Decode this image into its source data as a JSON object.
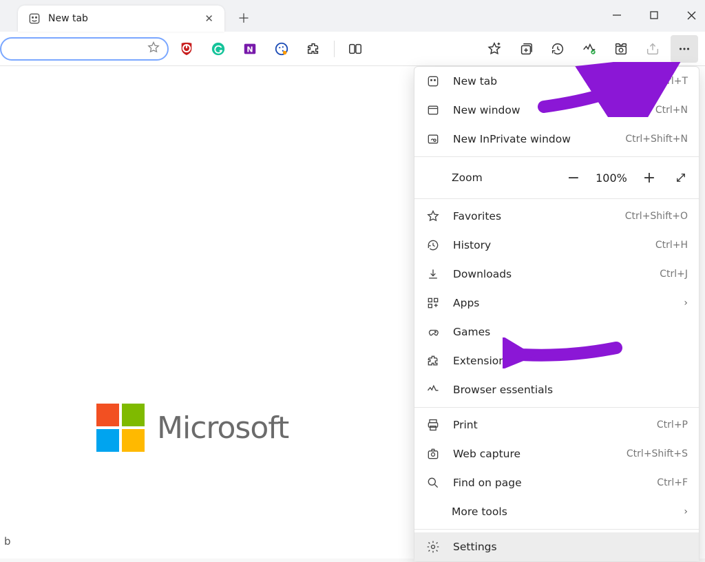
{
  "tab": {
    "title": "New tab"
  },
  "window": {
    "caption_buttons": [
      "min",
      "max",
      "close"
    ]
  },
  "page": {
    "brand": "Microsoft",
    "corner_text": "b"
  },
  "zoom": {
    "label": "Zoom",
    "value": "100%"
  },
  "menu": {
    "items": [
      {
        "icon": "new-tab",
        "label": "New tab",
        "accel": "Ctrl+T"
      },
      {
        "icon": "window",
        "label": "New window",
        "accel": "Ctrl+N"
      },
      {
        "icon": "inprivate",
        "label": "New InPrivate window",
        "accel": "Ctrl+Shift+N"
      }
    ],
    "items2": [
      {
        "icon": "star",
        "label": "Favorites",
        "accel": "Ctrl+Shift+O"
      },
      {
        "icon": "history",
        "label": "History",
        "accel": "Ctrl+H"
      },
      {
        "icon": "download",
        "label": "Downloads",
        "accel": "Ctrl+J"
      },
      {
        "icon": "apps",
        "label": "Apps",
        "chev": true
      },
      {
        "icon": "games",
        "label": "Games"
      },
      {
        "icon": "puzzle",
        "label": "Extensions"
      },
      {
        "icon": "heart",
        "label": "Browser essentials"
      }
    ],
    "items3": [
      {
        "icon": "print",
        "label": "Print",
        "accel": "Ctrl+P"
      },
      {
        "icon": "capture",
        "label": "Web capture",
        "accel": "Ctrl+Shift+S"
      },
      {
        "icon": "find",
        "label": "Find on page",
        "accel": "Ctrl+F"
      },
      {
        "icon": "",
        "label": "More tools",
        "chev": true
      }
    ],
    "items4": [
      {
        "icon": "gear",
        "label": "Settings",
        "hl": true
      }
    ]
  },
  "annotations": {
    "arrow1": "points-to-more-button",
    "arrow2": "points-to-extensions"
  }
}
